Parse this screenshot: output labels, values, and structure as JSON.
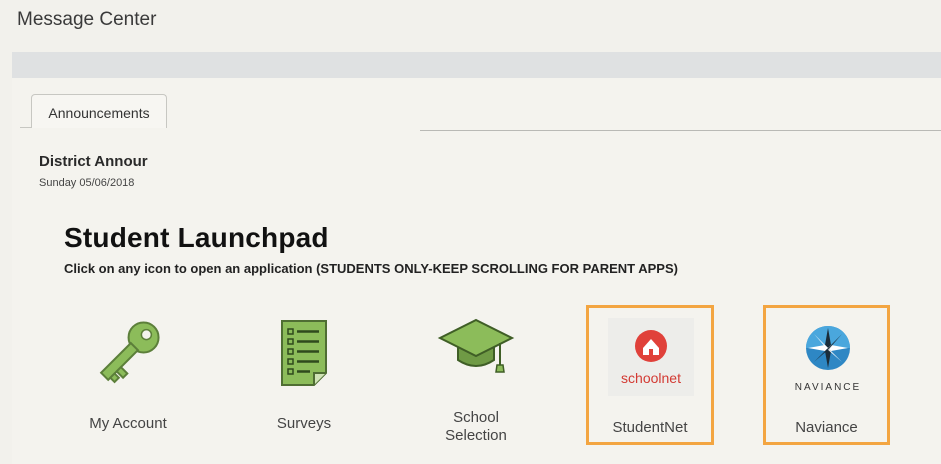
{
  "header": {
    "title": "Message Center"
  },
  "tabs": [
    {
      "label": "Announcements"
    }
  ],
  "announcement": {
    "title": "District Annour",
    "date": "Sunday 05/06/2018"
  },
  "launchpad": {
    "title": "Student Launchpad",
    "subtitle": "Click on any icon to open an application (STUDENTS ONLY-KEEP SCROLLING FOR PARENT APPS)",
    "apps": [
      {
        "label": "My Account",
        "icon": "key-icon"
      },
      {
        "label": "Surveys",
        "icon": "checklist-icon"
      },
      {
        "label_line1": "School",
        "label_line2": "Selection",
        "icon": "graduation-cap-icon"
      },
      {
        "label": "StudentNet",
        "icon": "schoolnet-logo",
        "logo_text": "schoolnet"
      },
      {
        "label": "Naviance",
        "icon": "naviance-logo",
        "logo_text": "NAVIANCE"
      }
    ]
  },
  "colors": {
    "highlight": "#f3a541",
    "icon_green": "#88b857",
    "schoolnet_red": "#e0413a"
  }
}
